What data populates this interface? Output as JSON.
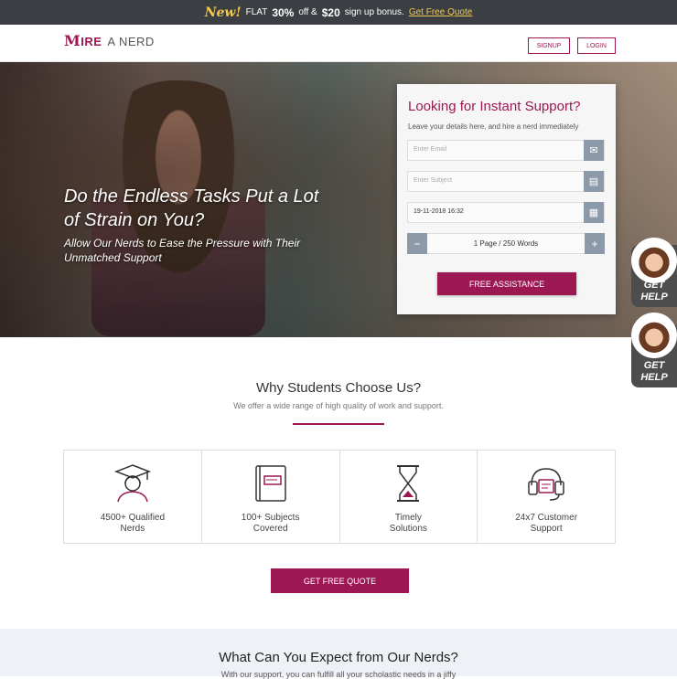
{
  "promo": {
    "new": "New!",
    "text1": "FLAT",
    "pct": "30%",
    "text2": "off  &",
    "amount": "$20",
    "text3": "sign up bonus.",
    "link": "Get Free Quote"
  },
  "nav": {
    "logo_m": "M",
    "logo_ire": "IRE",
    "logo_nerd": "A NERD",
    "signup": "SIGNUP",
    "login": "LOGIN"
  },
  "hero": {
    "title": "Do the Endless Tasks Put a Lot of Strain on You?",
    "subtitle": "Allow Our Nerds to Ease the Pressure with Their Unmatched Support"
  },
  "form": {
    "title": "Looking for Instant Support?",
    "subtitle": "Leave your details here, and hire a nerd immediately",
    "email_placeholder": "Enter Email",
    "subject_placeholder": "Enter Subject",
    "date_value": "19-11-2018 16:32",
    "pages_value": "1 Page / 250 Words",
    "minus": "−",
    "plus": "+",
    "submit": "FREE ASSISTANCE"
  },
  "help": {
    "label1": "GET\nHELP",
    "label2": "GET\nHELP"
  },
  "why": {
    "title": "Why Students Choose Us?",
    "subtitle": "We offer a wide range of high quality of work and support.",
    "features": [
      {
        "label": "4500+ Qualified\nNerds",
        "icon": "graduate-icon"
      },
      {
        "label": "100+ Subjects\nCovered",
        "icon": "book-icon"
      },
      {
        "label": "Timely\nSolutions",
        "icon": "hourglass-icon"
      },
      {
        "label": "24x7 Customer\nSupport",
        "icon": "headset-icon"
      }
    ],
    "cta": "GET FREE QUOTE"
  },
  "expect": {
    "title": "What Can You Expect from Our Nerds?",
    "subtitle": "With our support, you can fulfill all your scholastic needs in a jiffy"
  },
  "colors": {
    "brand": "#9c1853",
    "promo_bg": "#3b3f44",
    "icon_bg": "#8c99a8"
  }
}
